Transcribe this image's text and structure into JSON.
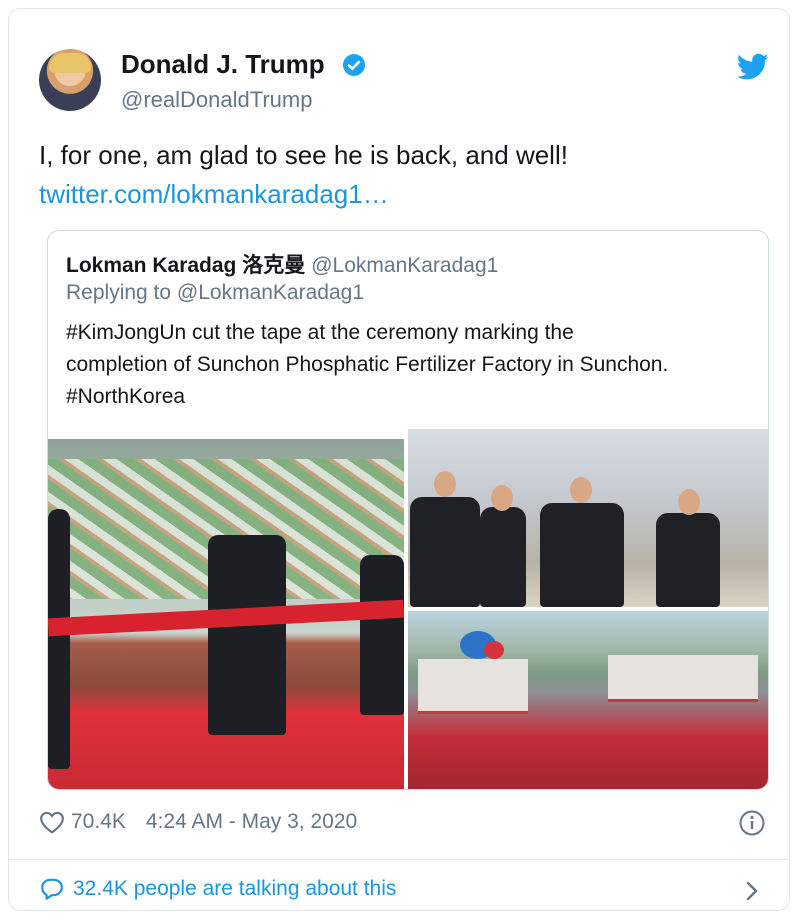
{
  "author": {
    "name": "Donald J. Trump",
    "handle": "@realDonaldTrump",
    "avatar_icon": "profile-photo",
    "verified_icon": "verified-badge-icon"
  },
  "brand": {
    "icon": "twitter-bird-icon",
    "color": "#1da1f2"
  },
  "tweet": {
    "text": "I, for one, am glad to see he is back, and well!",
    "link": "twitter.com/lokmankaradag1…"
  },
  "quoted": {
    "name": "Lokman Karadag 洛克曼",
    "handle": "@LokmanKaradag1",
    "replying": "Replying to @LokmanKaradag1",
    "text_lines": [
      "#KimJongUn cut the tape at the ceremony marking the",
      "completion of Sunchon Phosphatic Fertilizer Factory in Sunchon.",
      "#NorthKorea"
    ]
  },
  "footer": {
    "likes": "70.4K",
    "timestamp": "4:24 AM - May 3, 2020",
    "talking": "32.4K people are talking about this"
  },
  "colors": {
    "link": "#1b95e0",
    "muted": "#657786",
    "border": "#e1e8ed"
  }
}
